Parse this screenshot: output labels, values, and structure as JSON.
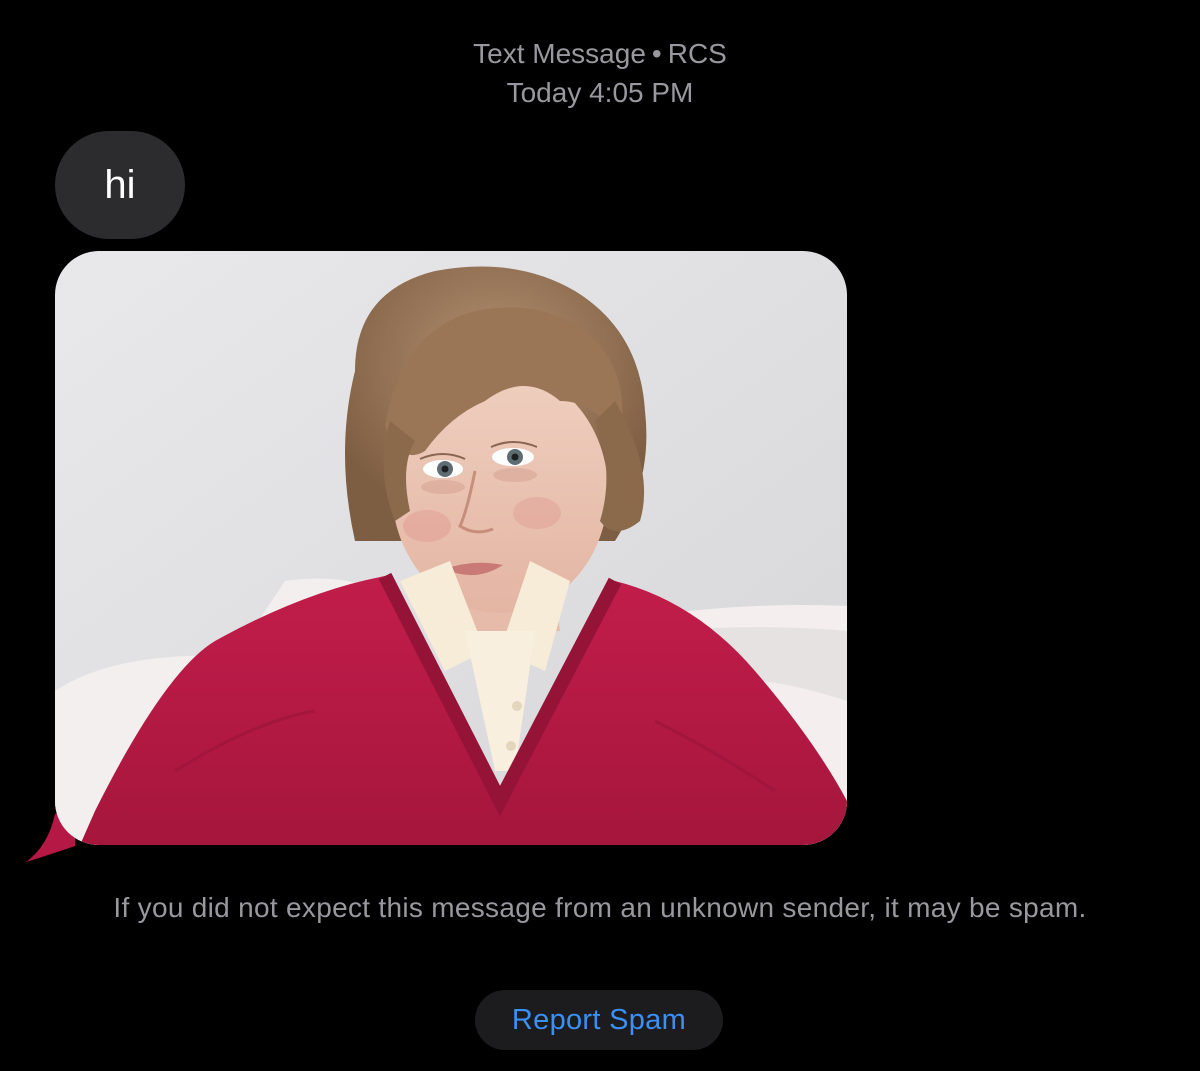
{
  "header": {
    "channel": "Text Message",
    "separator": "•",
    "protocol": "RCS",
    "timestamp": "Today 4:05 PM"
  },
  "messages": [
    {
      "type": "text",
      "text": "hi"
    },
    {
      "type": "image",
      "subject": "selfie-photo"
    }
  ],
  "spam_notice": "If you did not expect this message from an unknown sender, it may be spam.",
  "report_button": {
    "label": "Report Spam"
  },
  "colors": {
    "background": "#000000",
    "incoming_bubble": "#2c2c2e",
    "secondary_text": "#98989e",
    "link_blue": "#3b8ff5",
    "button_bg": "#1c1c1e"
  }
}
